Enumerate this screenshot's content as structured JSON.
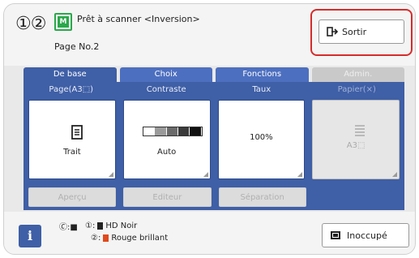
{
  "header": {
    "drum_numbers": "①②",
    "mode_icon": "M",
    "status_text": "Prêt à scanner <Inversion>",
    "page_no": "Page No.2",
    "exit_label": "Sortir"
  },
  "tabs": [
    {
      "label": "De base",
      "state": "active"
    },
    {
      "label": "Choix",
      "state": "normal"
    },
    {
      "label": "Fonctions",
      "state": "normal"
    },
    {
      "label": "Admin.",
      "state": "disabled"
    }
  ],
  "columns": [
    {
      "heading": "Page(A3⬚)",
      "value": "Trait",
      "icon": "document-icon"
    },
    {
      "heading": "Contraste",
      "value": "Auto",
      "icon": "contrast-gauge-icon"
    },
    {
      "heading": "Taux",
      "value": "100%",
      "icon": ""
    },
    {
      "heading": "Papier(⨯)",
      "value": "A3⬚",
      "icon": "paper-stack-icon"
    }
  ],
  "bottom_buttons": [
    "Aperçu",
    "Editeur",
    "Séparation"
  ],
  "footer": {
    "info_label": "i",
    "drum_label": "🄫:■",
    "ink1_num": "①:",
    "ink1_name": "HD Noir",
    "ink2_num": "②:",
    "ink2_name": "Rouge brillant",
    "ink1_color": "#222222",
    "ink2_color": "#e04a1c",
    "status_button": "Inoccupé"
  },
  "colors": {
    "tab_active": "#3f5fa6",
    "exit_highlight": "#d62c2c",
    "mode_badge": "#2aa84a"
  }
}
